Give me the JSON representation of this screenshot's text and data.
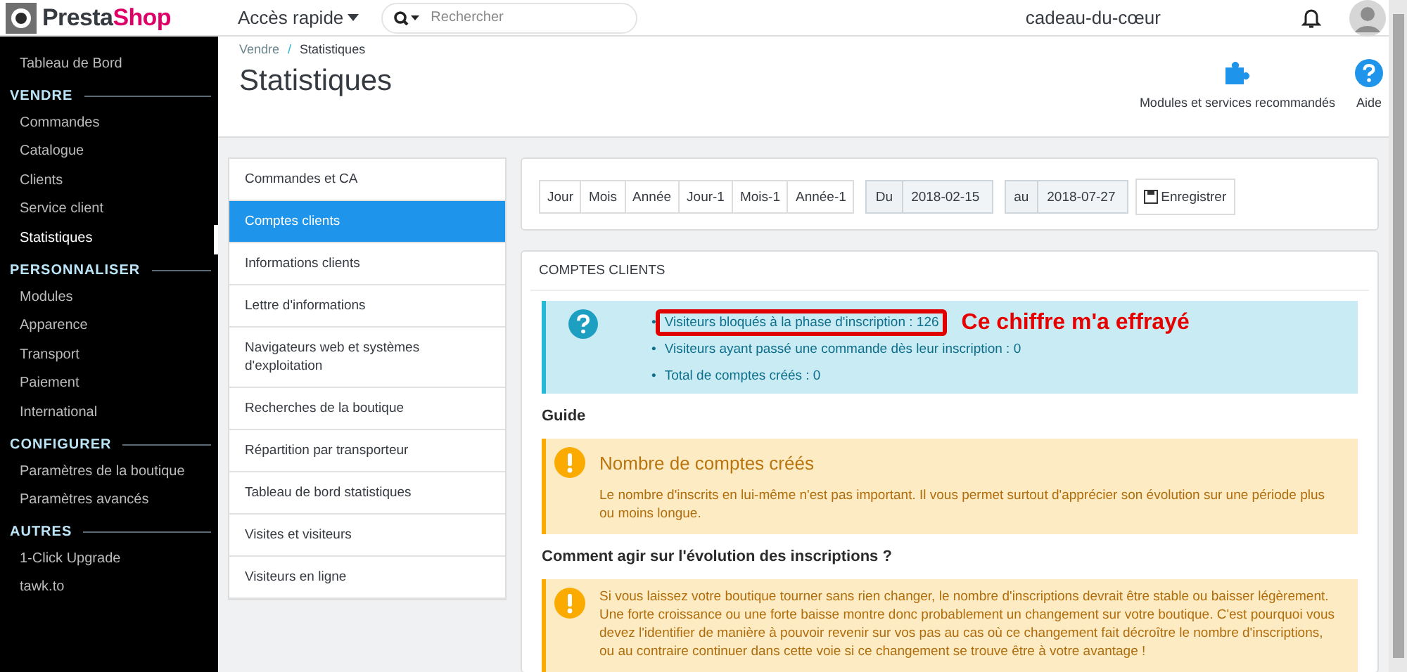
{
  "logo": {
    "parts": [
      "Presta",
      "Shop"
    ]
  },
  "topbar": {
    "quick_access": "Accès rapide",
    "search": {
      "placeholder": "Rechercher"
    },
    "shop_name": "cadeau-du-cœur"
  },
  "sidebar": {
    "top_item": "Tableau de Bord",
    "sections": [
      {
        "title": "VENDRE",
        "items": [
          {
            "label": "Commandes",
            "selected": false
          },
          {
            "label": "Catalogue",
            "selected": false
          },
          {
            "label": "Clients",
            "selected": false
          },
          {
            "label": "Service client",
            "selected": false
          },
          {
            "label": "Statistiques",
            "selected": true
          }
        ]
      },
      {
        "title": "PERSONNALISER",
        "items": [
          {
            "label": "Modules",
            "selected": false
          },
          {
            "label": "Apparence",
            "selected": false
          },
          {
            "label": "Transport",
            "selected": false
          },
          {
            "label": "Paiement",
            "selected": false
          },
          {
            "label": "International",
            "selected": false
          }
        ]
      },
      {
        "title": "CONFIGURER",
        "items": [
          {
            "label": "Paramètres de la boutique",
            "selected": false
          },
          {
            "label": "Paramètres avancés",
            "selected": false
          }
        ]
      },
      {
        "title": "AUTRES",
        "items": [
          {
            "label": "1-Click Upgrade",
            "selected": false
          },
          {
            "label": "tawk.to",
            "selected": false
          }
        ]
      }
    ]
  },
  "page_header": {
    "breadcrumb": [
      "Vendre",
      "/",
      "Statistiques"
    ],
    "title": "Statistiques",
    "actions": [
      {
        "kind": "modules",
        "label": "Modules et services recommandés"
      },
      {
        "kind": "help",
        "label": "Aide"
      }
    ]
  },
  "stats_menu": [
    {
      "label": "Commandes et CA",
      "selected": false
    },
    {
      "label": "Comptes clients",
      "selected": true
    },
    {
      "label": "Informations clients",
      "selected": false
    },
    {
      "label": "Lettre d'informations",
      "selected": false
    },
    {
      "label": "Navigateurs web et systèmes d'exploitation",
      "selected": false
    },
    {
      "label": "Recherches de la boutique",
      "selected": false
    },
    {
      "label": "Répartition par transporteur",
      "selected": false
    },
    {
      "label": "Tableau de bord statistiques",
      "selected": false
    },
    {
      "label": "Visites et visiteurs",
      "selected": false
    },
    {
      "label": "Visiteurs en ligne",
      "selected": false
    }
  ],
  "period_buttons": [
    "Jour",
    "Mois",
    "Année",
    "Jour-1",
    "Mois-1",
    "Année-1"
  ],
  "date_range": {
    "from_label": "Du",
    "from": "2018-02-15",
    "to_label": "au",
    "to": "2018-07-27",
    "save": "Enregistrer"
  },
  "panel": {
    "title": "COMPTES CLIENTS",
    "info": [
      {
        "bullet": "•",
        "text": "Visiteurs bloqués à la phase d'inscription : 126",
        "highlighted": true
      },
      {
        "bullet": "•",
        "text": "Visiteurs ayant passé une commande dès leur inscription : 0",
        "highlighted": false
      },
      {
        "bullet": "•",
        "text": "Total de comptes créés : 0",
        "highlighted": false
      }
    ],
    "annotation": "Ce chiffre m'a effrayé",
    "guide_heading": "Guide",
    "guide_alert": {
      "title": "Nombre de comptes créés",
      "text": "Le nombre d'inscrits en lui-même n'est pas important. Il vous permet surtout d'apprécier son évolution sur une période plus ou moins longue."
    },
    "advice_heading": "Comment agir sur l'évolution des inscriptions ?",
    "advice_alert": {
      "text": "Si vous laissez votre boutique tourner sans rien changer, le nombre d'inscriptions devrait être stable ou baisser légèrement. Une forte croissance ou une forte baisse montre donc probablement un changement sur votre boutique. C'est pourquoi vous devez l'identifier de manière à pouvoir revenir sur vos pas au cas où ce changement fait décroître le nombre d'inscriptions, ou au contraire continuer dans cette voie si ce changement se trouve être à votre avantage !"
    }
  }
}
